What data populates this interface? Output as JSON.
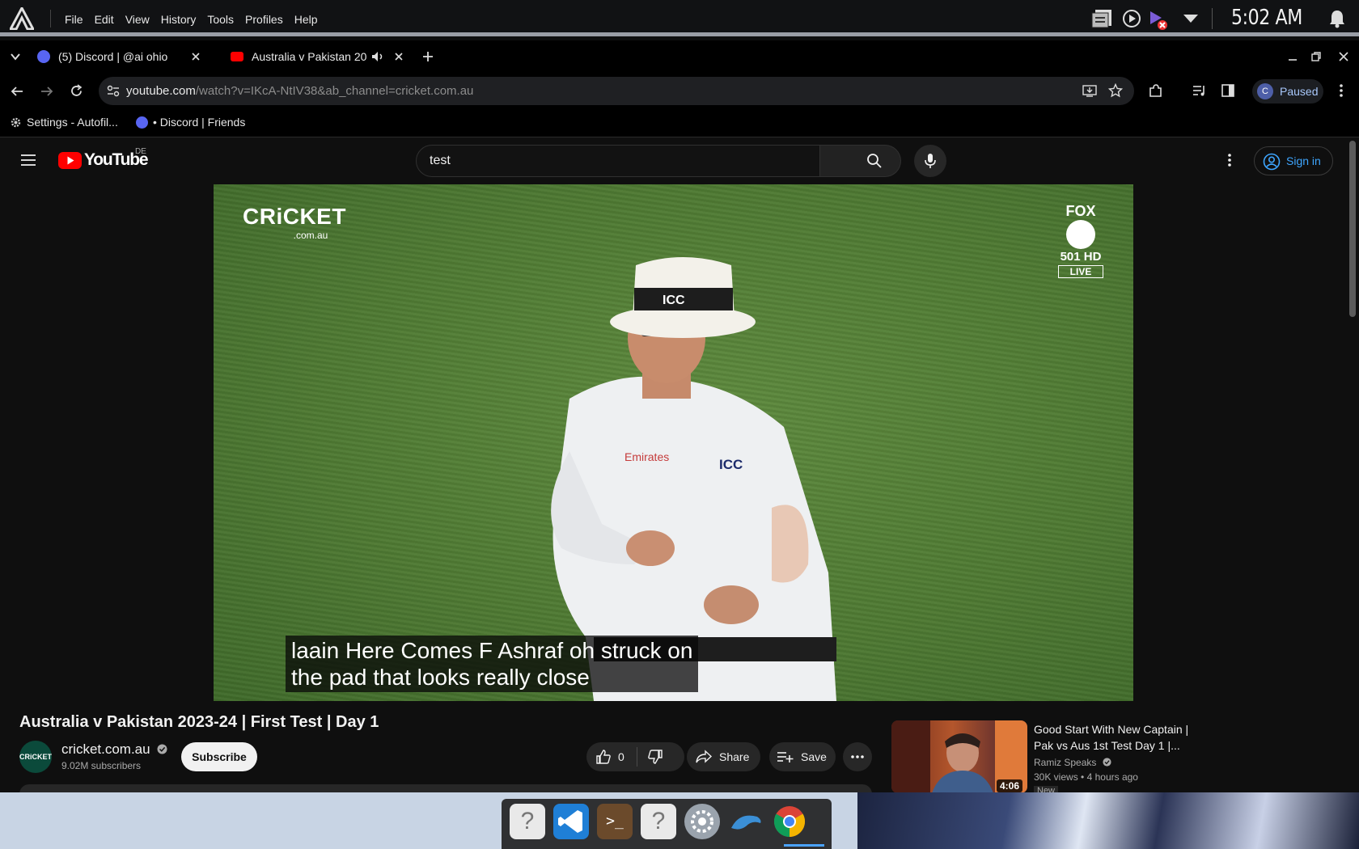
{
  "system": {
    "menu": [
      "File",
      "Edit",
      "View",
      "History",
      "Tools",
      "Profiles",
      "Help"
    ],
    "clock": "5:02 AM"
  },
  "tabs": [
    {
      "label": "(5) Discord | @ai ohio",
      "icon": "discord-icon"
    },
    {
      "label": "Australia v Pakistan 20",
      "icon": "youtube-icon",
      "audio": true
    }
  ],
  "address": {
    "host": "youtube.com",
    "path": "/watch?v=IKcA-NtIV38&ab_channel=cricket.com.au"
  },
  "profile": {
    "initial": "C",
    "status": "Paused"
  },
  "bookmarks": [
    {
      "label": "Settings - Autofil...",
      "icon": "gear-icon"
    },
    {
      "label": "• Discord | Friends",
      "icon": "discord-icon"
    }
  ],
  "youtube": {
    "logo_text": "YouTube",
    "region": "DE",
    "search_value": "test",
    "signin_label": "Sign in"
  },
  "video": {
    "caption_line1": "laain Here Comes F Ashraf oh struck on",
    "caption_line2": "the pad that looks really close",
    "overlay_left": "CRiCKET",
    "overlay_left_sub": ".com.au",
    "overlay_right_top": "FOX",
    "overlay_right_mid": "501 HD",
    "overlay_right_bottom": "LIVE",
    "title": "Australia v Pakistan 2023-24 | First Test | Day 1",
    "channel": "cricket.com.au",
    "subscribers": "9.02M subscribers",
    "subscribe_label": "Subscribe",
    "likes": "0",
    "share_label": "Share",
    "save_label": "Save"
  },
  "recommended": {
    "title": "Good Start With New Captain | Pak vs Aus 1st Test Day 1 |...",
    "channel": "Ramiz Speaks",
    "views": "30K views",
    "age": "4 hours ago",
    "badge": "New",
    "duration": "4:06"
  },
  "colors": {
    "accent": "#3ea6ff",
    "youtube_red": "#ff0000",
    "bg": "#0f0f0f"
  }
}
